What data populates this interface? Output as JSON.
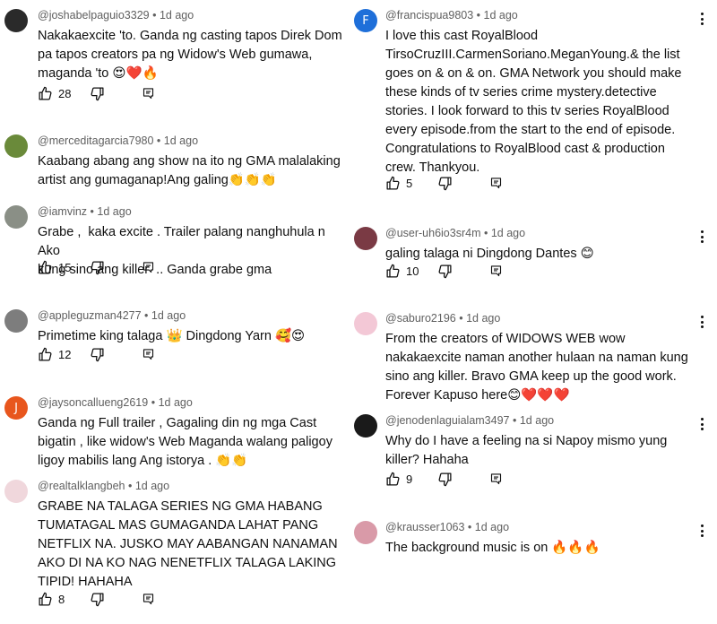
{
  "left": [
    {
      "author": "@joshabelpaguio3329",
      "time": "1d ago",
      "text": "Nakakaexcite 'to. Ganda ng casting tapos Direk Dom\npa tapos creators pa ng Widow's Web gumawa,\nmaganda 'to 😍❤️🔥",
      "likes": "28",
      "avatar_color": "#2a2a2a",
      "avatar_letter": ""
    },
    {
      "author": "@merceditagarcia7980",
      "time": "1d ago",
      "text": "Kaabang abang ang show na ito ng GMA malalaking\nartist ang gumaganap!Ang galing👏👏👏",
      "likes": "",
      "avatar_color": "#6a8a3a",
      "avatar_letter": ""
    },
    {
      "author": "@iamvinz",
      "time": "1d ago",
      "text": "Grabe ,  kaka excite . Trailer palang nanghuhula n Ako\nkung sino ang killer  .. Ganda grabe gma",
      "likes": "15",
      "avatar_color": "#8a8f86",
      "avatar_letter": ""
    },
    {
      "author": "@appleguzman4277",
      "time": "1d ago",
      "text": "Primetime king talaga 👑 Dingdong Yarn 🥰😍",
      "likes": "12",
      "avatar_color": "#7d7d7d",
      "avatar_letter": ""
    },
    {
      "author": "@jaysoncallueng2619",
      "time": "1d ago",
      "text": "Ganda ng Full trailer , Gagaling din ng mga Cast\nbigatin , like widow's Web Maganda walang paligoy\nligoy mabilis lang Ang istorya . 👏👏",
      "likes": "",
      "avatar_color": "#e8561d",
      "avatar_letter": "J"
    },
    {
      "author": "@realtalklangbeh",
      "time": "1d ago",
      "text": "GRABE NA TALAGA SERIES NG GMA HABANG\nTUMATAGAL MAS GUMAGANDA LAHAT PANG\nNETFLIX NA. JUSKO MAY AABANGAN NANAMAN\nAKO DI NA KO NAG NENETFLIX TALAGA LAKING\nTIPID! HAHAHA",
      "likes": "8",
      "avatar_color": "#f0d7dc",
      "avatar_letter": ""
    }
  ],
  "right": [
    {
      "author": "@francispua9803",
      "time": "1d ago",
      "text": "I love this cast RoyalBlood\nTirsoCruzIII.CarmenSoriano.MeganYoung.& the list\ngoes on & on & on. GMA Network you should make\nthese kinds of tv series crime mystery.detective\nstories. I look forward to this tv series RoyalBlood\nevery episode.from the start to the end of episode.\nCongratulations to RoyalBlood cast & production\ncrew. Thankyou.",
      "likes": "5",
      "avatar_color": "#1e6fd9",
      "avatar_letter": "F"
    },
    {
      "author": "@user-uh6io3sr4m",
      "time": "1d ago",
      "text": "galing talaga ni Dingdong Dantes 😊",
      "likes": "10",
      "avatar_color": "#7a3a44",
      "avatar_letter": ""
    },
    {
      "author": "@saburo2196",
      "time": "1d ago",
      "text": "From the creators of WIDOWS WEB wow\nnakakaexcite naman another hulaan na naman kung\nsino ang killer. Bravo GMA keep up the good work.\nForever Kapuso here😊❤️❤️❤️",
      "likes": "",
      "avatar_color": "#f3c8d6",
      "avatar_letter": ""
    },
    {
      "author": "@jenodenlaguialam3497",
      "time": "1d ago",
      "text": "Why do I have a feeling na si Napoy mismo yung\nkiller? Hahaha",
      "likes": "9",
      "avatar_color": "#1a1a1a",
      "avatar_letter": ""
    },
    {
      "author": "@krausser1063",
      "time": "1d ago",
      "text": "The background music is on 🔥🔥🔥",
      "likes": "",
      "avatar_color": "#d99aa8",
      "avatar_letter": ""
    }
  ],
  "meta_separator": "•"
}
